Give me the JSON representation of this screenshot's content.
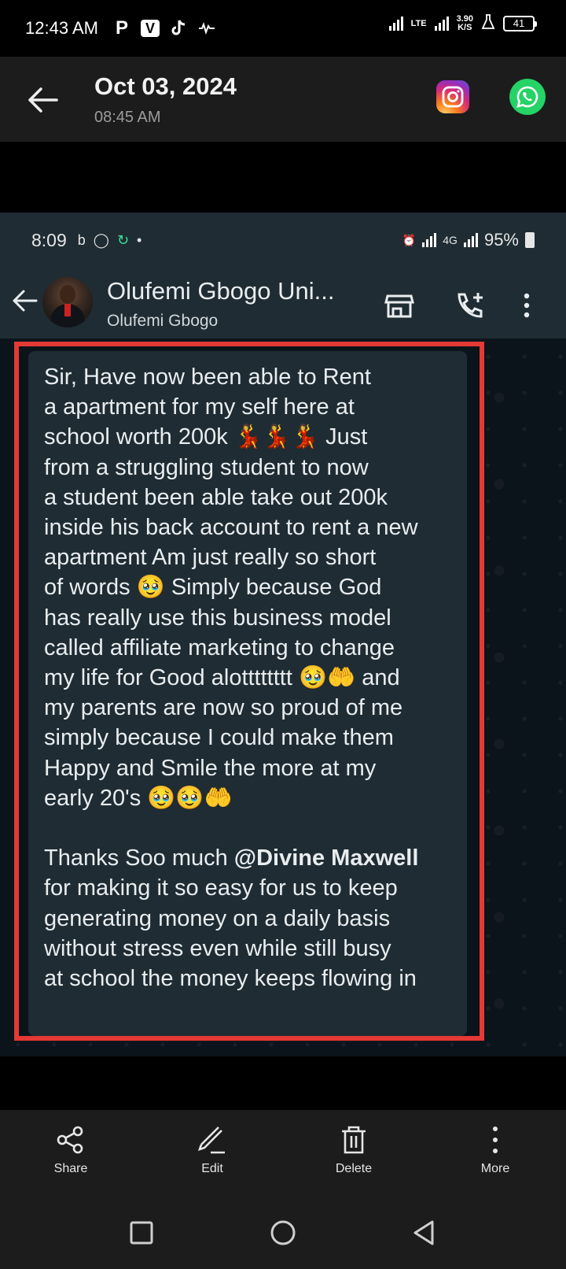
{
  "status_bar": {
    "time": "12:43 AM",
    "app_icons": [
      "P",
      "V"
    ],
    "lte": "LTE",
    "net_speed_value": "3.90",
    "net_speed_unit": "K/S",
    "battery": "41"
  },
  "header": {
    "date": "Oct 03, 2024",
    "time": "08:45 AM"
  },
  "screenshot": {
    "status": {
      "time": "8:09",
      "battery": "95%",
      "network": "4G"
    },
    "chat": {
      "name": "Olufemi Gbogo Uni...",
      "subtitle": "Olufemi Gbogo"
    },
    "message": {
      "part1": "Sir, Have now been able to Rent\na apartment for my self here at\nschool worth 200k 💃💃💃 Just\nfrom a struggling student to now\na student been able take out 200k\ninside his back account to rent a new\napartment Am just really so short\nof words 🥹 Simply because God\nhas really use this business model\ncalled affiliate marketing to change\nmy life for Good alotttttttt 🥹🤲 and\nmy parents are now so proud of me\nsimply because I could make them\nHappy and Smile the more at my\nearly 20's 🥹🥹🤲\n\nThanks Soo much ",
      "mention": "@Divine Maxwell",
      "part2": "\nfor making it so easy for us to keep\ngenerating money on a daily basis\nwithout stress even while still busy\nat school the money keeps flowing in"
    }
  },
  "toolbar": {
    "share": "Share",
    "edit": "Edit",
    "delete": "Delete",
    "more": "More"
  },
  "colors": {
    "highlight_border": "#e53935",
    "whatsapp_green": "#25d366",
    "chat_bubble": "#1f2c33"
  }
}
